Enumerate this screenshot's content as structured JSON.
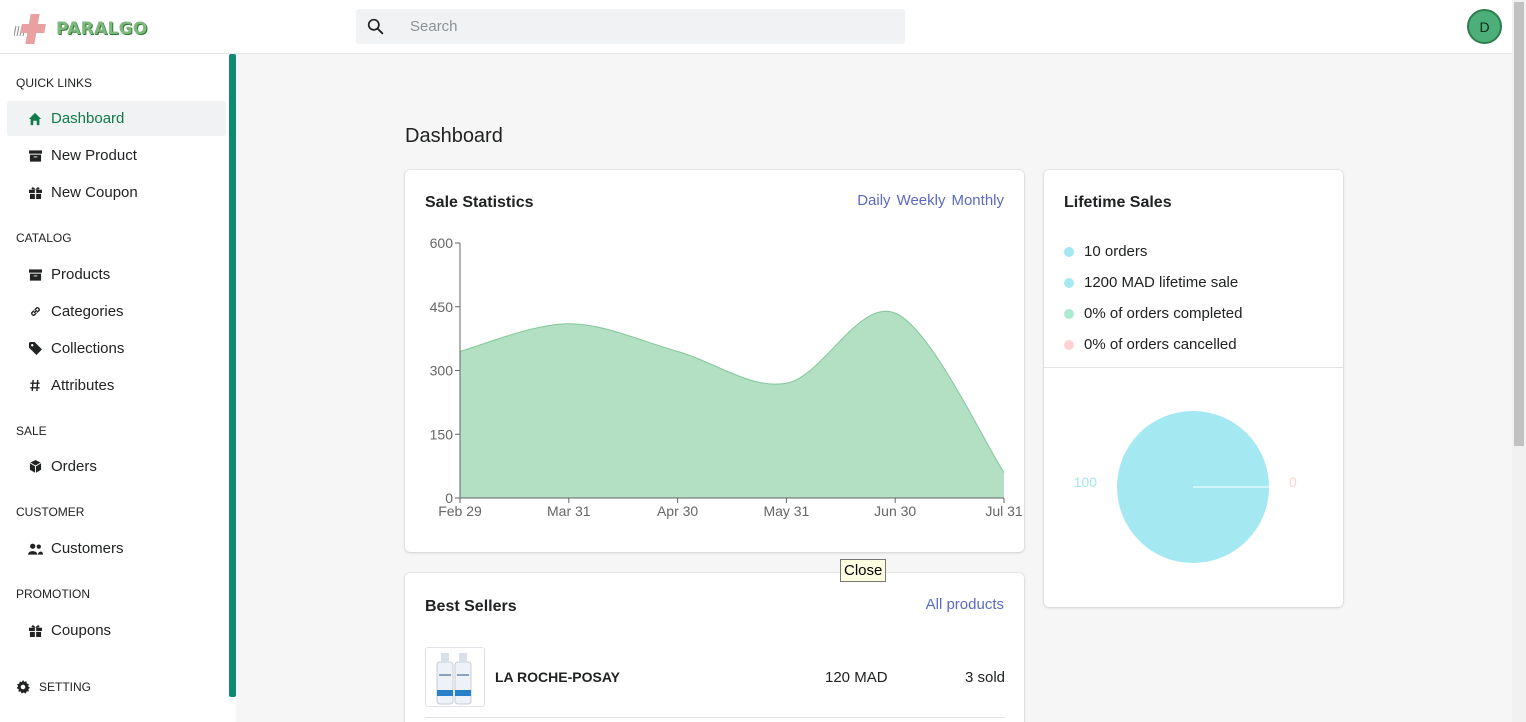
{
  "app": {
    "brand": "PARALGO",
    "search_placeholder": "Search",
    "avatar_initial": "D"
  },
  "sidebar": {
    "sections": [
      {
        "title": "QUICK LINKS",
        "items": [
          {
            "label": "Dashboard",
            "icon": "home-icon",
            "active": true
          },
          {
            "label": "New Product",
            "icon": "archive-icon"
          },
          {
            "label": "New Coupon",
            "icon": "gift-icon"
          }
        ]
      },
      {
        "title": "CATALOG",
        "items": [
          {
            "label": "Products",
            "icon": "archive-icon"
          },
          {
            "label": "Categories",
            "icon": "link-icon"
          },
          {
            "label": "Collections",
            "icon": "tag-icon"
          },
          {
            "label": "Attributes",
            "icon": "hash-icon"
          }
        ]
      },
      {
        "title": "SALE",
        "items": [
          {
            "label": "Orders",
            "icon": "cube-icon"
          }
        ]
      },
      {
        "title": "CUSTOMER",
        "items": [
          {
            "label": "Customers",
            "icon": "users-icon"
          }
        ]
      },
      {
        "title": "PROMOTION",
        "items": [
          {
            "label": "Coupons",
            "icon": "gift-icon"
          }
        ]
      }
    ],
    "setting_label": "SETTING"
  },
  "main": {
    "title": "Dashboard",
    "sale_statistics": {
      "title": "Sale Statistics",
      "period_links": [
        "Daily",
        "Weekly",
        "Monthly"
      ]
    },
    "lifetime_sales": {
      "title": "Lifetime Sales",
      "stats": [
        {
          "text": "10 orders",
          "color": "#a4e8f2"
        },
        {
          "text": "1200 MAD lifetime sale",
          "color": "#a4e8f2"
        },
        {
          "text": "0% of orders completed",
          "color": "#aee9d1"
        },
        {
          "text": "0% of orders cancelled",
          "color": "#fed3d1"
        }
      ],
      "pie_labels": {
        "left": "100",
        "right": "0"
      }
    },
    "best_sellers": {
      "title": "Best Sellers",
      "all_products_link": "All products",
      "items": [
        {
          "name": "LA ROCHE-POSAY",
          "price": "120 MAD",
          "sold": "3 sold"
        }
      ]
    },
    "tooltip": "Close"
  },
  "chart_data": [
    {
      "type": "area",
      "title": "",
      "x": [
        "Feb 29",
        "Mar 31",
        "Apr 30",
        "May 31",
        "Jun 30",
        "Jul 31"
      ],
      "series": [
        {
          "values": [
            345,
            410,
            345,
            270,
            435,
            60
          ]
        }
      ],
      "ylim": [
        0,
        600
      ],
      "yticks": [
        0,
        150,
        300,
        450,
        600
      ],
      "grid": false,
      "color": "#b3dfc3",
      "stroke": "#82c89a"
    },
    {
      "type": "pie",
      "labels": [
        "100",
        "0"
      ],
      "values": [
        100,
        0
      ],
      "colors": [
        "#a4e8f2",
        "#fed3d1"
      ]
    }
  ]
}
